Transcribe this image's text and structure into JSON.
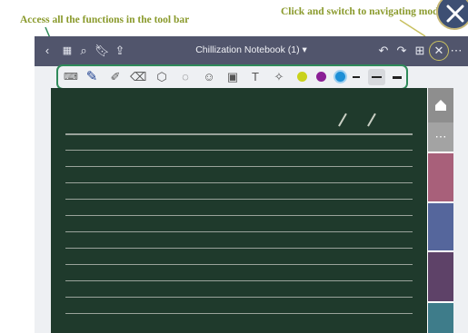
{
  "annotations": {
    "toolbar_caption": "Access all the functions in the tool bar",
    "navigate_caption": "Click and switch to navigating mode"
  },
  "appbar": {
    "title": "Chillization Notebook (1)"
  },
  "icons": {
    "back": "chevron-left-icon",
    "grid": "grid-icon",
    "search": "search-icon",
    "bookmark": "bookmark-icon",
    "share": "share-icon",
    "undo": "undo-icon",
    "redo": "redo-icon",
    "add_page": "add-page-icon",
    "close": "close-icon",
    "more": "more-icon"
  },
  "toolbar": {
    "tools": [
      "keyboard-lasso",
      "pen",
      "highlighter",
      "eraser",
      "shape",
      "lasso",
      "sticker",
      "image",
      "text",
      "laser"
    ],
    "colors": [
      "#c9d21c",
      "#8a1f95",
      "#1d8fd6"
    ]
  },
  "colors": {
    "paper": "#1f3a2c",
    "appbar": "#51556c",
    "accent_green": "#2f8a5a",
    "caption": "#8a9a2c"
  }
}
